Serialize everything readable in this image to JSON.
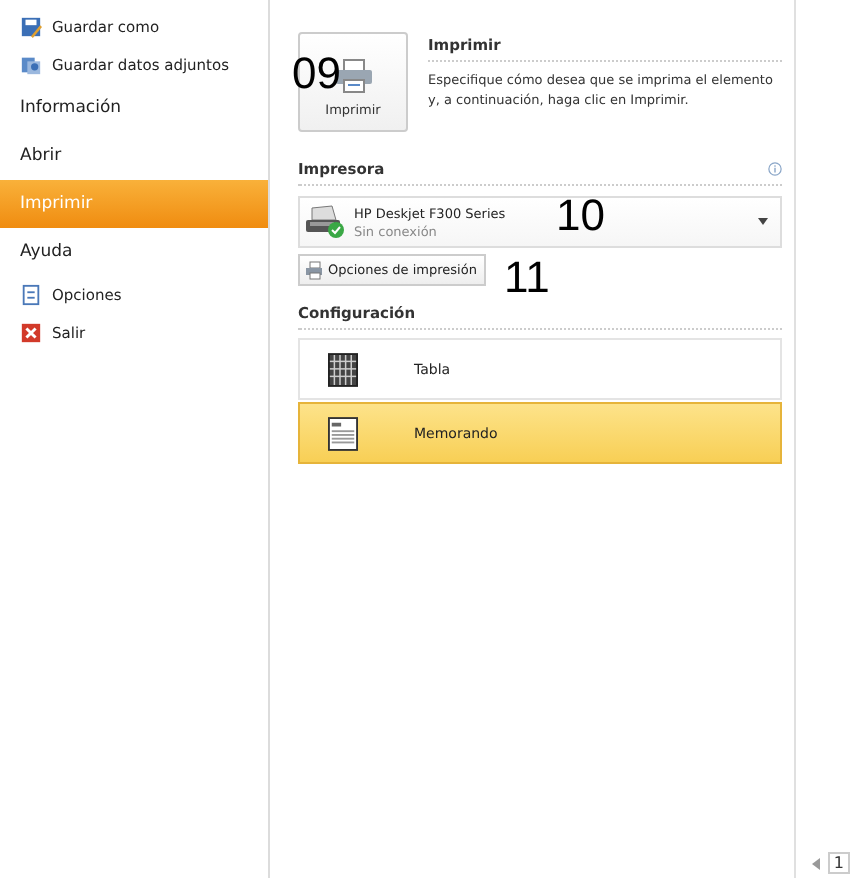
{
  "sidebar": {
    "items": [
      {
        "label": "Guardar como",
        "kind": "icon",
        "selected": false
      },
      {
        "label": "Guardar datos adjuntos",
        "kind": "icon",
        "selected": false
      },
      {
        "label": "Información",
        "kind": "tab",
        "selected": false
      },
      {
        "label": "Abrir",
        "kind": "tab",
        "selected": false
      },
      {
        "label": "Imprimir",
        "kind": "tab",
        "selected": true
      },
      {
        "label": "Ayuda",
        "kind": "tab",
        "selected": false
      },
      {
        "label": "Opciones",
        "kind": "icon",
        "selected": false
      },
      {
        "label": "Salir",
        "kind": "icon",
        "selected": false
      }
    ]
  },
  "print": {
    "button": "Imprimir",
    "title": "Imprimir",
    "description": "Especifique cómo desea que se imprima el elemento y, a continuación, haga clic en Imprimir."
  },
  "printer": {
    "heading": "Impresora",
    "name": "HP Deskjet F300 Series",
    "status": "Sin conexión",
    "options_button": "Opciones de impresión"
  },
  "settings": {
    "heading": "Configuración",
    "styles": [
      {
        "label": "Tabla",
        "selected": false
      },
      {
        "label": "Memorando",
        "selected": true
      }
    ]
  },
  "preview": {
    "page": "1"
  },
  "callouts": [
    "09",
    "10",
    "11"
  ]
}
